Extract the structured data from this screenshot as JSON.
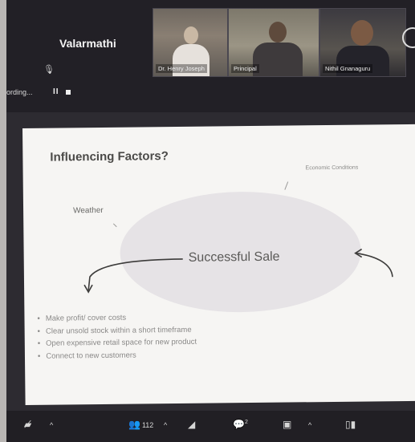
{
  "meeting": {
    "speaker_name": "Valarmathi",
    "recording_label": "ording...",
    "pause_label": "II",
    "participants": [
      {
        "name": "Dr. Henry Joseph"
      },
      {
        "name": "Principal"
      },
      {
        "name": "Nithil Gnanaguru"
      }
    ]
  },
  "slide": {
    "title": "Influencing Factors?",
    "weather_label": "Weather",
    "economic_label": "Economic Conditions",
    "center_label": "Successful Sale",
    "bullets": [
      "Make profit/ cover costs",
      "Clear unsold stock within a short timeframe",
      "Open expensive retail space for new product",
      "Connect to new customers"
    ]
  },
  "toolbar": {
    "participant_count": "112",
    "chat_badge": "2"
  },
  "colors": {
    "screen_bg": "#2d2b31",
    "slide_bg": "#f6f5f3",
    "oval": "#e6e3e6",
    "toolbar_bg": "#211f24"
  }
}
